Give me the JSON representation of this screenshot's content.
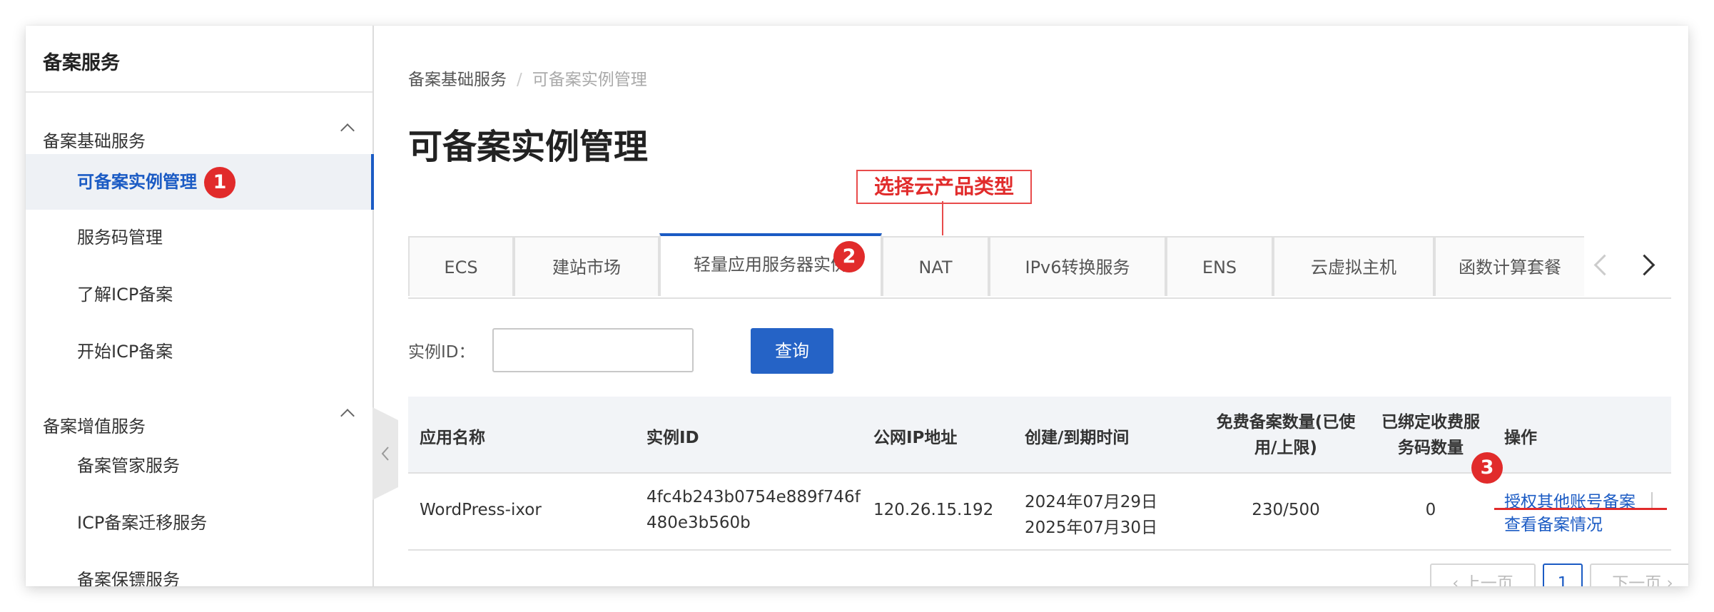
{
  "sidebar": {
    "title": "备案服务",
    "groups": [
      {
        "label": "备案基础服务",
        "items": [
          "可备案实例管理",
          "服务码管理",
          "了解ICP备案",
          "开始ICP备案"
        ]
      },
      {
        "label": "备案增值服务",
        "items": [
          "备案管家服务",
          "ICP备案迁移服务",
          "备案保镖服务"
        ]
      }
    ],
    "active_item": "可备案实例管理"
  },
  "markers": [
    "1",
    "2",
    "3"
  ],
  "breadcrumb": {
    "parent": "备案基础服务",
    "separator": "/",
    "current": "可备案实例管理"
  },
  "page_title": "可备案实例管理",
  "callout": "选择云产品类型",
  "tabs": [
    "ECS",
    "建站市场",
    "轻量应用服务器实例",
    "NAT",
    "IPv6转换服务",
    "ENS",
    "云虚拟主机",
    "函数计算套餐"
  ],
  "active_tab": "轻量应用服务器实例",
  "search": {
    "label": "实例ID：",
    "value": "",
    "placeholder": "",
    "button": "查询"
  },
  "table": {
    "headers": [
      "应用名称",
      "实例ID",
      "公网IP地址",
      "创建/到期时间",
      "免费备案数量(已使用/上限)",
      "已绑定收费服务码数量",
      "操作"
    ],
    "rows": [
      {
        "name": "WordPress-ixor",
        "instance_id_line1": "4fc4b243b0754e889f746f",
        "instance_id_line2": "480e3b560b",
        "ip": "120.26.15.192",
        "created": "2024年07月29日",
        "expires": "2025年07月30日",
        "free_quota": "230/500",
        "bound_codes": "0",
        "actions": [
          "授权其他账号备案",
          "查看备案情况"
        ]
      }
    ]
  },
  "pagination": {
    "prev": "上一页",
    "page": "1",
    "next": "下一页"
  },
  "colors": {
    "accent": "#1b5bc4",
    "marker": "#e12b2b",
    "button": "#2563c6"
  }
}
